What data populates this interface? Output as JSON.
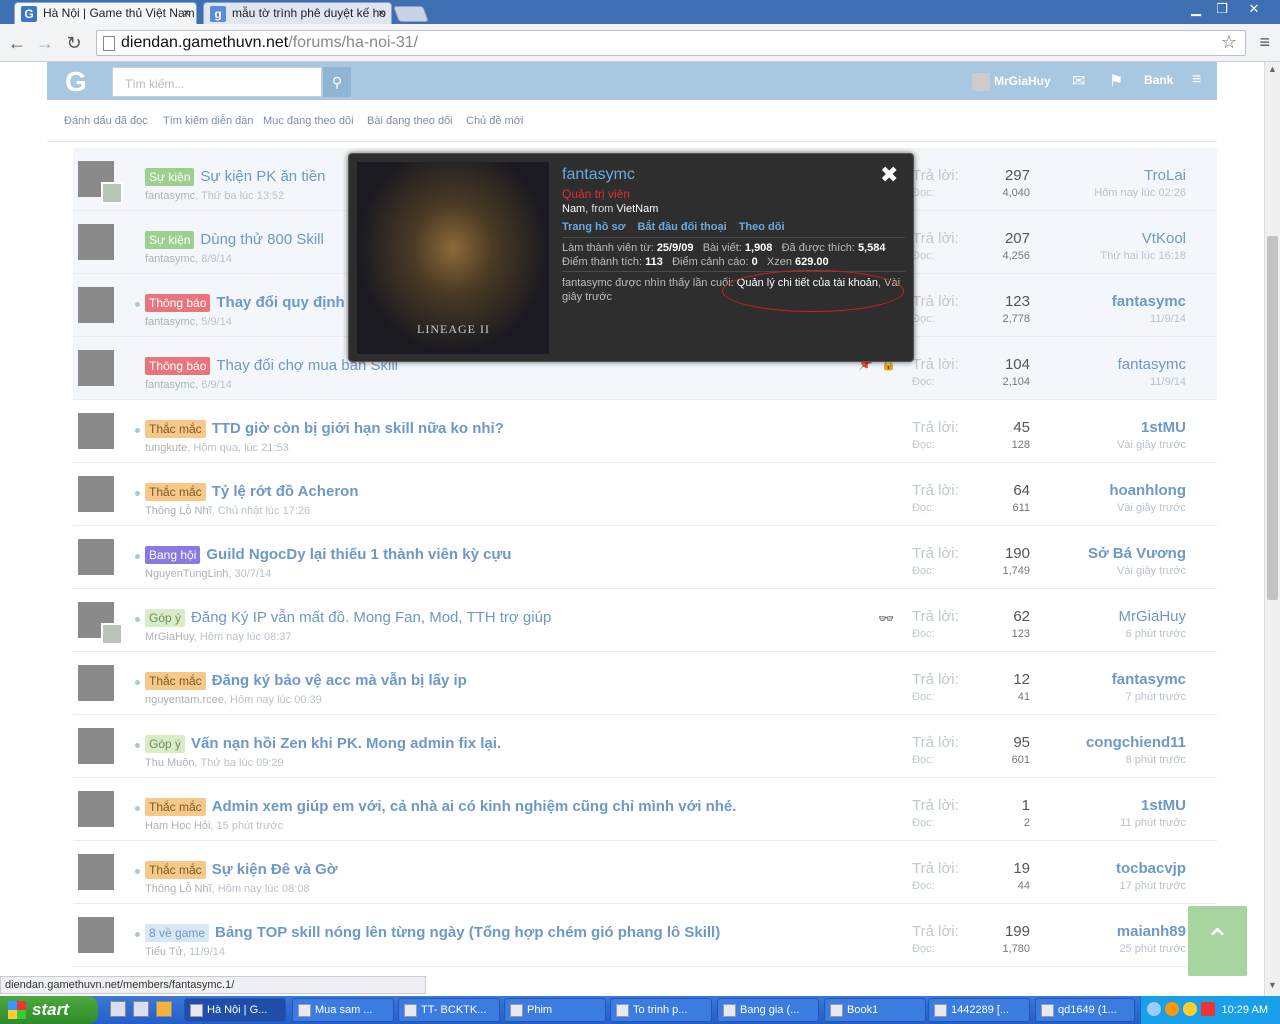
{
  "browser": {
    "tabs": [
      {
        "title": "Hà Nội | Game thủ Việt Nam",
        "favicon": "G",
        "close": "×"
      },
      {
        "title": "mẫu tờ trình phê duyệt kế ho",
        "favicon": "g",
        "close": "×"
      }
    ],
    "url_host": "diendan.gamethuvn.net",
    "url_path": "/forums/ha-noi-31/",
    "window_buttons": [
      "▁",
      "❐",
      "✕"
    ]
  },
  "header": {
    "logo": "G",
    "search_placeholder": "Tìm kiếm...",
    "username": "MrGiaHuy",
    "bank_label": "Bank"
  },
  "subnav": [
    "Đánh dấu đã đọc",
    "Tìm kiếm diễn đàn",
    "Mục đang theo dõi",
    "Bài đang theo dõi",
    "Chủ đề mới"
  ],
  "threads": [
    {
      "badge": "Sự kiện",
      "badge_class": "b-green",
      "title": "Sự kiện PK ăn tiền",
      "bold": false,
      "author": "fantasymc",
      "time": "Thứ ba lúc 13:52",
      "replies": "297",
      "views": "4,040",
      "last_user": "TroLai",
      "last_time": "Hôm nay lúc 02:26",
      "last_bold": false,
      "sticky": true,
      "mini": true
    },
    {
      "badge": "Sự kiện",
      "badge_class": "b-green",
      "title": "Dùng thử 800 Skill",
      "bold": false,
      "author": "fantasymc",
      "time": "8/9/14",
      "replies": "207",
      "views": "4,256",
      "last_user": "VtKool",
      "last_time": "Thứ hai lúc 16:18",
      "last_bold": false,
      "sticky": true
    },
    {
      "badge": "Thông báo",
      "badge_class": "b-red",
      "title": "Thay đổi quy định",
      "bold": true,
      "author": "fantasymc",
      "time": "5/9/14",
      "replies": "123",
      "views": "2,778",
      "last_user": "fantasymc",
      "last_time": "11/9/14",
      "last_bold": true,
      "sticky": true,
      "dot": true
    },
    {
      "badge": "Thông báo",
      "badge_class": "b-red",
      "title": "Thay đổi chợ mua bán Skill",
      "bold": false,
      "author": "fantasymc",
      "time": "6/9/14",
      "replies": "104",
      "views": "2,104",
      "last_user": "fantasymc",
      "last_time": "11/9/14",
      "last_bold": false,
      "sticky": true,
      "pin": "📌",
      "lock": "🔒"
    },
    {
      "badge": "Thắc mắc",
      "badge_class": "b-orange",
      "title": "TTD giờ còn bị giới hạn skill nữa ko nhỉ?",
      "bold": true,
      "author": "tungkute",
      "time": "Hôm qua, lúc 21:53",
      "replies": "45",
      "views": "128",
      "last_user": "1stMU",
      "last_time": "Vài giây trước",
      "last_bold": true,
      "dot": true
    },
    {
      "badge": "Thắc mắc",
      "badge_class": "b-orange",
      "title": "Tỷ lệ rớt đồ Acheron",
      "bold": true,
      "author": "Thông Lỗ Nhĩ",
      "time": "Chủ nhật lúc 17:26",
      "replies": "64",
      "views": "611",
      "last_user": "hoanhlong",
      "last_time": "Vài giây trước",
      "last_bold": true,
      "dot": true
    },
    {
      "badge": "Bang hội",
      "badge_class": "b-purple",
      "title": "Guild NgocDy lại thiếu 1 thành viên kỳ cựu",
      "bold": true,
      "author": "NguyenTungLinh",
      "time": "30/7/14",
      "replies": "190",
      "views": "1,749",
      "last_user": "Sở Bá Vương",
      "last_time": "Vài giây trước",
      "last_bold": true,
      "dot": true
    },
    {
      "badge": "Góp ý",
      "badge_class": "b-lgreen",
      "title": "Đăng Ký IP vẫn mất đồ. Mong Fan, Mod, TTH trợ giúp",
      "bold": false,
      "author": "MrGiaHuy",
      "time": "Hôm nay lúc 08:37",
      "replies": "62",
      "views": "123",
      "last_user": "MrGiaHuy",
      "last_time": "6 phút trước",
      "last_bold": false,
      "dot": true,
      "mini": true,
      "watch": "👓"
    },
    {
      "badge": "Thắc mắc",
      "badge_class": "b-orange",
      "title": "Đăng ký bảo vệ acc mà vẫn bị lấy ip",
      "bold": true,
      "author": "nguyentam.rcee",
      "time": "Hôm nay lúc 00:39",
      "replies": "12",
      "views": "41",
      "last_user": "fantasymc",
      "last_time": "7 phút trước",
      "last_bold": true,
      "dot": true
    },
    {
      "badge": "Góp ý",
      "badge_class": "b-lgreen",
      "title": "Vấn nạn hồi Zen khi PK. Mong admin fix lại.",
      "bold": true,
      "author": "Thu Muộn",
      "time": "Thứ ba lúc 09:29",
      "replies": "95",
      "views": "601",
      "last_user": "congchiend11",
      "last_time": "8 phút trước",
      "last_bold": true,
      "dot": true
    },
    {
      "badge": "Thắc mắc",
      "badge_class": "b-orange",
      "title": "Admin xem giúp em với, cả nhà ai có kinh nghiệm cũng chỉ mình với nhé.",
      "bold": true,
      "author": "Ham Học Hỏi",
      "time": "15 phút trước",
      "replies": "1",
      "views": "2",
      "last_user": "1stMU",
      "last_time": "11 phút trước",
      "last_bold": true,
      "dot": true
    },
    {
      "badge": "Thắc mắc",
      "badge_class": "b-orange",
      "title": "Sự kiện Đê và Gờ",
      "bold": true,
      "author": "Thông Lỗ Nhĩ",
      "time": "Hôm nay lúc 08:08",
      "replies": "19",
      "views": "44",
      "last_user": "tocbacvjp",
      "last_time": "17 phút trước",
      "last_bold": true,
      "dot": true
    },
    {
      "badge": "8 về game",
      "badge_class": "b-blue",
      "title": "Bảng TOP skill nóng lên từng ngày (Tổng hợp chém gió phang lô Skill)",
      "bold": true,
      "author": "Tiểu Tử",
      "time": "11/9/14",
      "replies": "199",
      "views": "1,780",
      "last_user": "maianh89",
      "last_time": "25 phút trước",
      "last_bold": true,
      "dot": true
    }
  ],
  "labels": {
    "replies": "Trả lời:",
    "views": "Đọc:"
  },
  "popup": {
    "name": "fantasymc",
    "role": "Quản trị viên",
    "gender": "Nam",
    "from_label": ", from",
    "country": "VietNam",
    "links": [
      "Trang hồ sơ",
      "Bắt đầu đối thoại",
      "Theo dõi"
    ],
    "joined_label": "Làm thành viên từ:",
    "joined": "25/9/09",
    "posts_label": "Bài viết:",
    "posts": "1,908",
    "likes_label": "Đã được thích:",
    "likes": "5,584",
    "trophy_label": "Điểm thành tích:",
    "trophy": "113",
    "warn_label": "Điểm cảnh cáo:",
    "warn": "0",
    "xzen_label": "Xzen",
    "xzen": "629.00",
    "seen_prefix": "fantasymc được nhìn thấy lần cuối:",
    "seen_activity": "Quản lý chi tiết của tài khoản",
    "seen_time": ", Vài giây trước",
    "image_text": "LINEAGE II",
    "close": "✖"
  },
  "status_url": "diendan.gamethuvn.net/members/fantasymc.1/",
  "taskbar": {
    "start": "start",
    "tasks": [
      "Hà Nội | G...",
      "Mua sam ...",
      "TT- BCKTK...",
      "Phim",
      "To trinh p...",
      "Bang gia (...",
      "Book1",
      "1442289 [...",
      "qd1649 (1..."
    ],
    "clock": "10:29 AM"
  },
  "to_top": "⌃"
}
